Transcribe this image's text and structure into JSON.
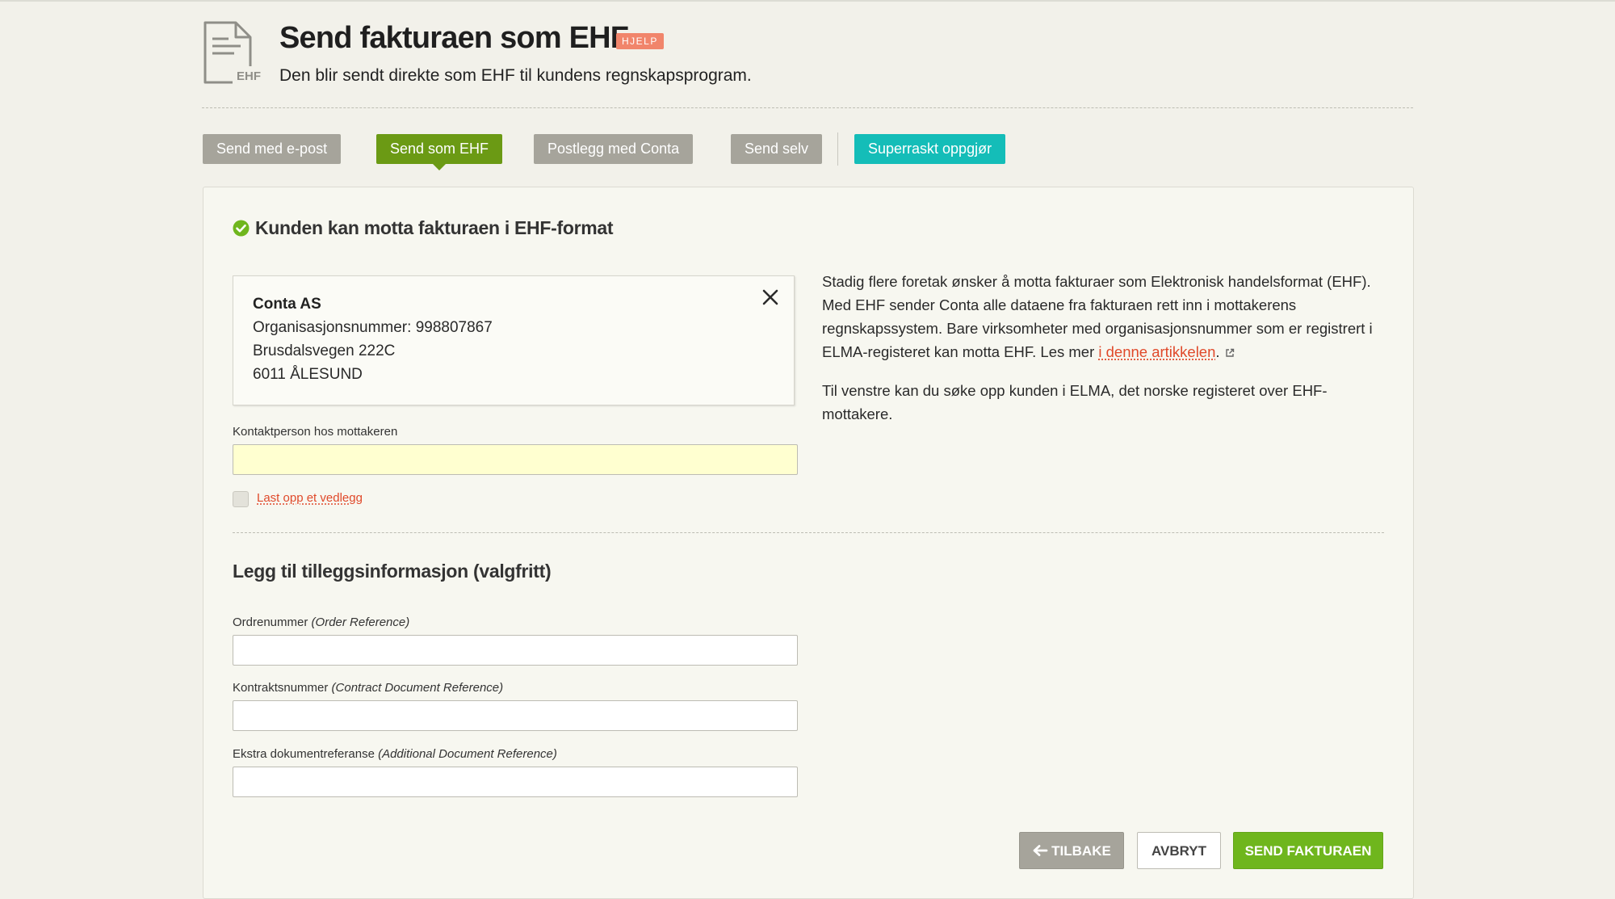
{
  "header": {
    "icon_label": "EHF",
    "title": "Send fakturaen som EHF",
    "help_badge": "HJELP",
    "subtitle": "Den blir sendt direkte som EHF til kundens regnskapsprogram."
  },
  "tabs": [
    {
      "label": "Send med e-post",
      "active": false
    },
    {
      "label": "Send som EHF",
      "active": true
    },
    {
      "label": "Postlegg med Conta",
      "active": false
    },
    {
      "label": "Send selv",
      "active": false
    },
    {
      "label": "Superraskt oppgjør",
      "active": false
    }
  ],
  "status": {
    "heading": "Kunden kan motta fakturaen i EHF-format"
  },
  "customer": {
    "name": "Conta AS",
    "org_number": "Organisasjonsnummer: 998807867",
    "street": "Brusdalsvegen 222C",
    "postal": "6011 ÅLESUND"
  },
  "contact": {
    "label": "Kontaktperson hos mottakeren",
    "value": ""
  },
  "attachment": {
    "link_label": "Last opp et vedlegg",
    "checked": false
  },
  "info": {
    "paragraph1_pre": "Stadig flere foretak ønsker å motta fakturaer som Elektronisk handelsformat (EHF). Med EHF sender Conta alle dataene fra fakturaen rett inn i mottakerens regnskapssystem. Bare virksomheter med organisasjonsnummer som er registrert i ELMA-registeret kan motta EHF. Les mer ",
    "paragraph1_link": "i denne artikkelen",
    "paragraph1_post": ".",
    "paragraph2": "Til venstre kan du søke opp kunden i ELMA, det norske registeret over EHF-mottakere."
  },
  "additional": {
    "heading": "Legg til tilleggsinformasjon (valgfritt)",
    "fields": [
      {
        "label": "Ordrenummer",
        "hint": "(Order Reference)",
        "value": ""
      },
      {
        "label": "Kontraktsnummer",
        "hint": "(Contract Document Reference)",
        "value": ""
      },
      {
        "label": "Ekstra dokumentreferanse",
        "hint": "(Additional Document Reference)",
        "value": ""
      }
    ]
  },
  "footer": {
    "back_label": "TILBAKE",
    "cancel_label": "AVBRYT",
    "send_label": "SEND FAKTURAEN"
  },
  "colors": {
    "background": "#f2f1ea",
    "tab_inactive": "#a6a49b",
    "tab_active": "#6b9a14",
    "tab_teal": "#14bdb8",
    "help_badge": "#f1856b",
    "link": "#e0492a",
    "send_button": "#6fb61d",
    "contact_field": "#ffffd0"
  },
  "icons": {
    "header": "document-icon",
    "status": "check-circle-icon",
    "card_close": "close-icon",
    "article_link": "external-link-icon",
    "back_button": "arrow-left-icon"
  }
}
